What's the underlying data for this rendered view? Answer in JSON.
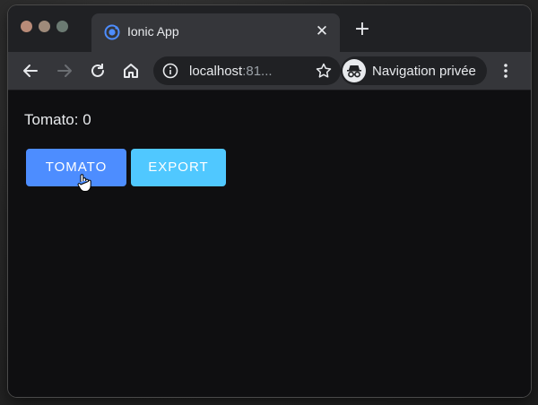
{
  "browser": {
    "tab_title": "Ionic App",
    "tab_close_glyph": "✕",
    "new_tab_glyph": "+",
    "url_host": "localhost",
    "url_rest": ":81...",
    "profile_label": "Navigation privée",
    "accent_color": "#4d8dff"
  },
  "icons": {
    "back": "back-arrow-icon",
    "forward": "forward-arrow-icon",
    "reload": "reload-icon",
    "home": "home-icon",
    "info": "info-icon",
    "star": "star-icon",
    "incognito": "incognito-icon",
    "menu": "more-vert-icon",
    "favicon": "ionic-favicon-icon",
    "cursor": "hand-pointer-icon"
  },
  "app": {
    "counter_text": "Tomato: 0",
    "buttons": [
      {
        "label": "Tomato",
        "color": "#4d8dff"
      },
      {
        "label": "Export",
        "color": "#50c8ff"
      }
    ]
  }
}
